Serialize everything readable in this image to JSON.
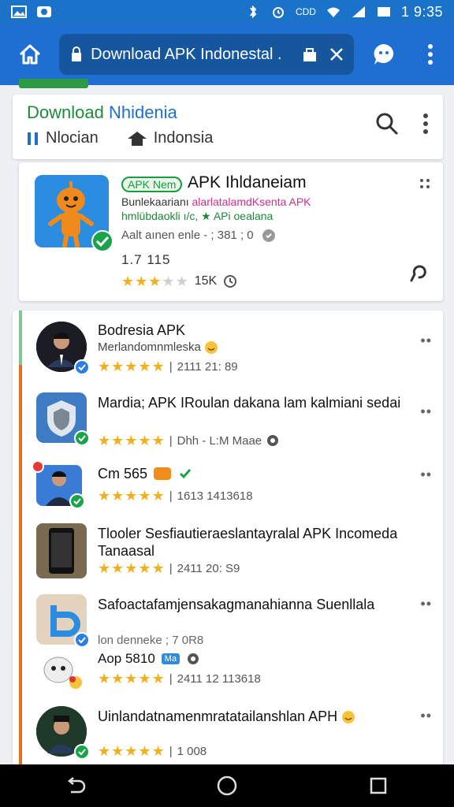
{
  "status_bar": {
    "time": "1 9:35",
    "carrier": "CDD"
  },
  "browser": {
    "url_text": "Download APK Indonestal .",
    "colors": {
      "bar": "#1e6fd1",
      "url_box": "#15569f"
    }
  },
  "header": {
    "title_part1": "Download ",
    "title_part2": "Nhidenia",
    "tab1_label": "Nlocian",
    "tab2_label": "Indonsia"
  },
  "featured": {
    "badge": "APK Nem",
    "title": "APK Ihldaneiam",
    "line1_a": "Bunlekaarianı ",
    "line1_b": "alarlatalamdKsenta APK",
    "line2": "hmlübdaokli ı/c, ★ APi oealana",
    "line3": "Aalt aınen enle - ; 381 ; 0",
    "size": "1.7  115",
    "rating": 3,
    "count": "15K"
  },
  "list": [
    {
      "title": "Bodresia APK",
      "subtitle": "Merlandomnmleska",
      "meta": "2111 21: 89",
      "rating": 4.5
    },
    {
      "title": "Mardia; APK IRoulan dakana lam kalmiani sedai",
      "subtitle": "",
      "meta": "Dhh - L:M Maae",
      "rating": 5
    },
    {
      "title": "Cm  565",
      "subtitle": "",
      "meta": "1613 1413618",
      "rating": 4.5
    },
    {
      "title": "Tlooler Sesfiautieraeslantayralal APK Incomeda Tanaasal",
      "subtitle": "",
      "meta": "2411 20: S9",
      "rating": 4.5
    },
    {
      "title": "Safoactafamjensakagmanahianna Suenllala",
      "subtitle": "lon denneke ; 7 0R8",
      "extra_title": "Aop 5810",
      "extra_badge": "Ma",
      "meta": "2411 12 113618",
      "rating": 4.5
    },
    {
      "title": "Uinlandatnamenmratatailanshlan APH",
      "subtitle": "",
      "meta": "1 008",
      "rating": 5
    }
  ]
}
